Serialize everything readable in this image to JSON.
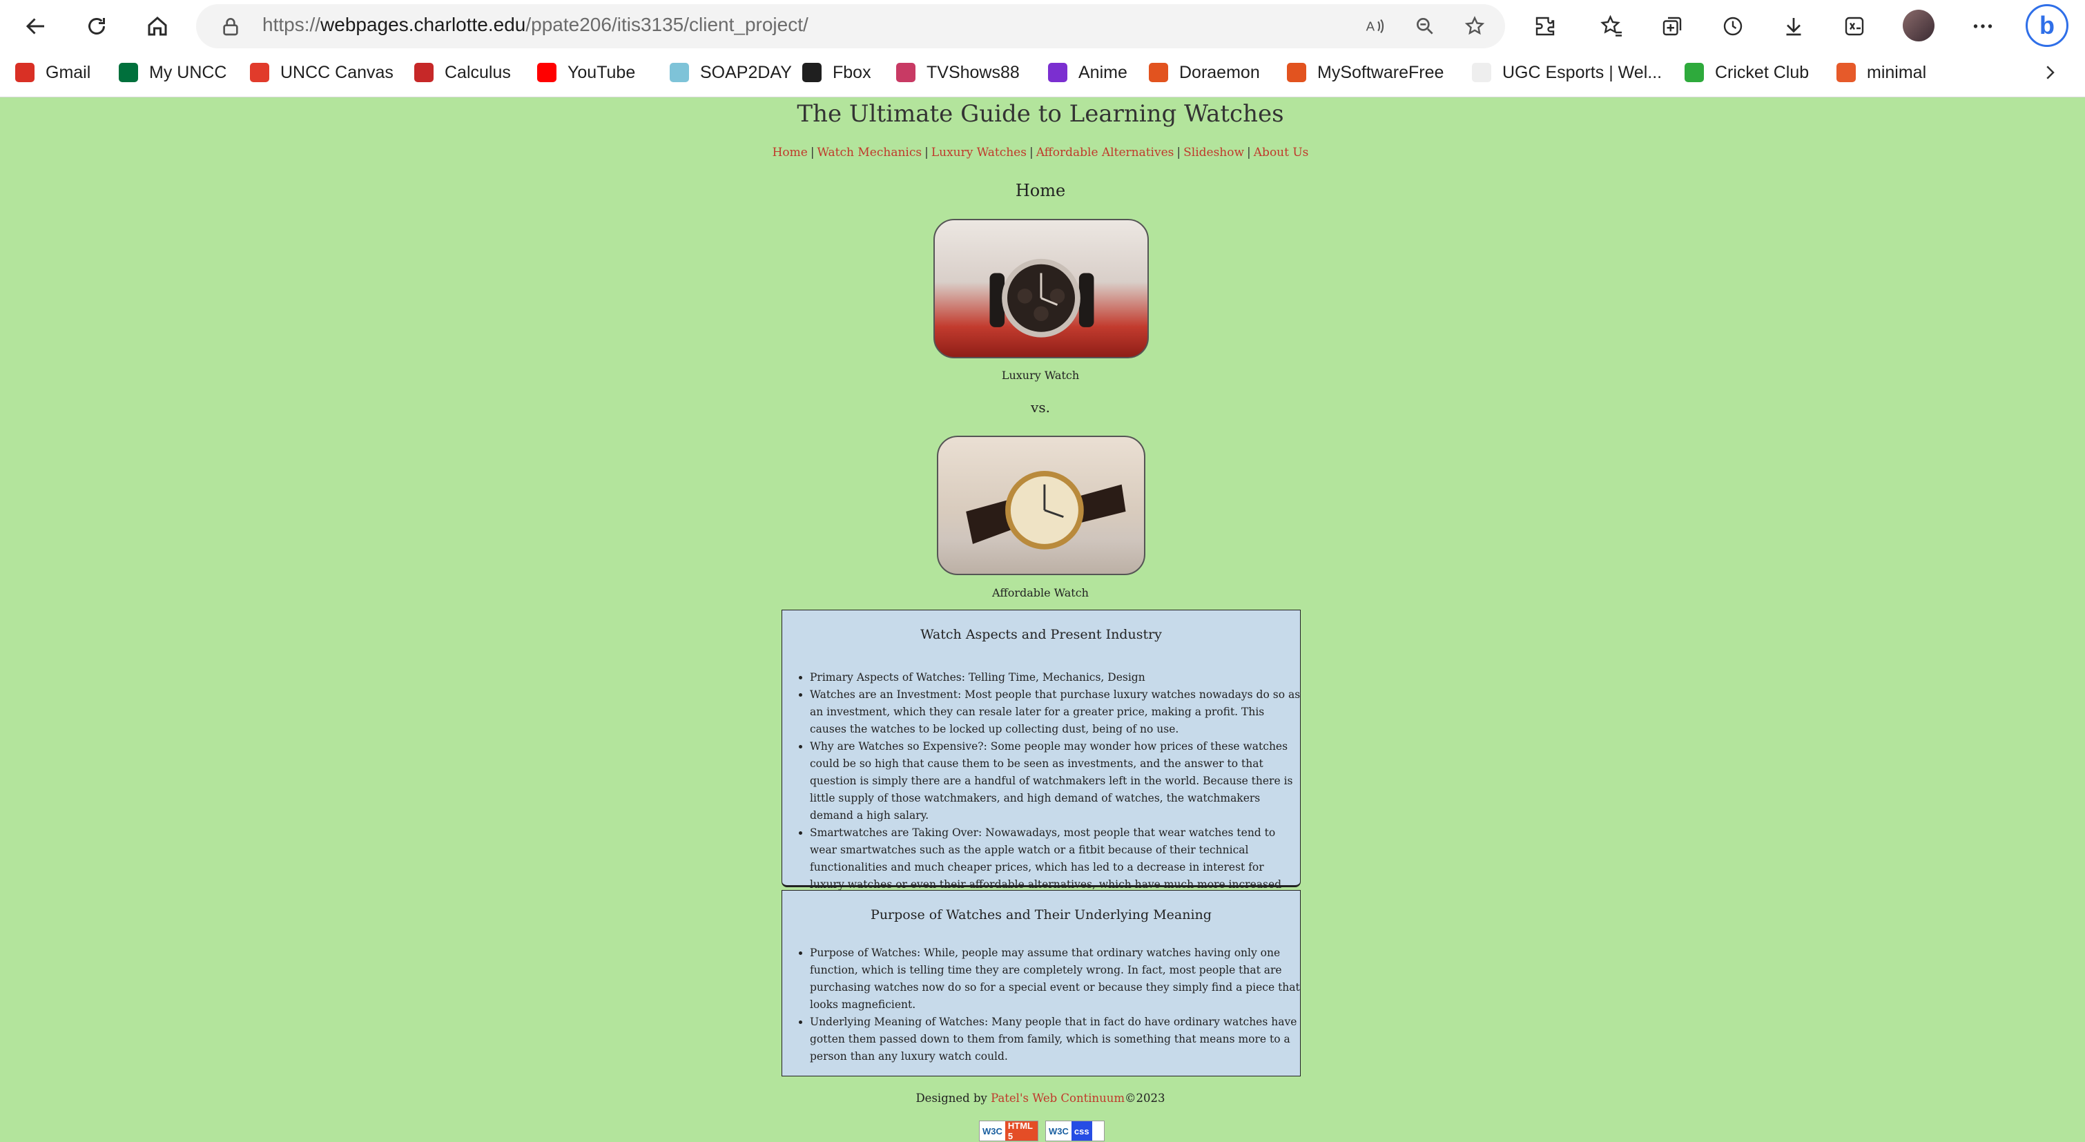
{
  "browser": {
    "url_scheme": "https://",
    "url_host": "webpages.charlotte.edu",
    "url_path": "/ppate206/itis3135/client_project/",
    "bookmarks": [
      {
        "label": "Gmail",
        "icon": "gmail-icon",
        "color": "#d93025"
      },
      {
        "label": "My UNCC",
        "icon": "uncc-icon",
        "color": "#00703c"
      },
      {
        "label": "UNCC Canvas",
        "icon": "canvas-icon",
        "color": "#e13b2b"
      },
      {
        "label": "Calculus",
        "icon": "calculus-icon",
        "color": "#c62828"
      },
      {
        "label": "YouTube",
        "icon": "youtube-icon",
        "color": "#ff0000"
      },
      {
        "label": "SOAP2DAY",
        "icon": "soap2day-icon",
        "color": "#7ec3d8"
      },
      {
        "label": "Fbox",
        "icon": "fbox-icon",
        "color": "#1f1f1f"
      },
      {
        "label": "TVShows88",
        "icon": "tvshows-icon",
        "color": "#c83a64"
      },
      {
        "label": "Anime",
        "icon": "anime-icon",
        "color": "#7b2fd0"
      },
      {
        "label": "Doraemon",
        "icon": "doraemon-icon",
        "color": "#e2531f"
      },
      {
        "label": "MySoftwareFree",
        "icon": "download-icon",
        "color": "#e2531f"
      },
      {
        "label": "UGC Esports | Wel...",
        "icon": "ugc-icon",
        "color": "#eeeeee"
      },
      {
        "label": "Cricket Club",
        "icon": "cricket-icon",
        "color": "#2eaa3c"
      },
      {
        "label": "minimal",
        "icon": "flame-icon",
        "color": "#e65a2a"
      }
    ]
  },
  "page": {
    "title": "The Ultimate Guide to Learning Watches",
    "nav": [
      "Home",
      "Watch Mechanics",
      "Luxury Watches",
      "Affordable Alternatives",
      "Slideshow",
      "About Us"
    ],
    "nav_separator": "|",
    "section_heading": "Home",
    "luxury_caption": "Luxury Watch",
    "vs_text": "vs.",
    "affordable_caption": "Affordable Watch",
    "panel1": {
      "title": "Watch Aspects and Present Industry",
      "items": [
        "Primary Aspects of Watches: Telling Time, Mechanics, Design",
        "Watches are an Investment: Most people that purchase luxury watches nowadays do so as an investment, which they can resale later for a greater price, making a profit. This causes the watches to be locked up collecting dust, being of no use.",
        "Why are Watches so Expensive?: Some people may wonder how prices of these watches could be so high that cause them to be seen as investments, and the answer to that question is simply there are a handful of watchmakers left in the world. Because there is little supply of those watchmakers, and high demand of watches, the watchmakers demand a high salary.",
        "Smartwatches are Taking Over: Nowawadays, most people that wear watches tend to wear smartwatches such as the apple watch or a fitbit because of their technical functionalities and much cheaper prices, which has led to a decrease in interest for luxury watches or even their affordable alternatives, which have much more increased prices."
      ]
    },
    "panel2": {
      "title": "Purpose of Watches and Their Underlying Meaning",
      "items": [
        "Purpose of Watches: While, people may assume that ordinary watches having only one function, which is telling time they are completely wrong. In fact, most people that are purchasing watches now do so for a special event or because they simply find a piece that looks magneficient.",
        "Underlying Meaning of Watches: Many people that in fact do have ordinary watches have gotten them passed down to them from family, which is something that means more to a person than any luxury watch could."
      ]
    },
    "footer": {
      "prefix": "Designed by ",
      "link": "Patel's Web Continuum",
      "suffix": "©2023"
    },
    "badges": [
      {
        "w3c": "W3C",
        "label": "HTML 5",
        "color": "#e44d26"
      },
      {
        "w3c": "W3C",
        "label": "css",
        "color": "#264de4"
      }
    ]
  }
}
